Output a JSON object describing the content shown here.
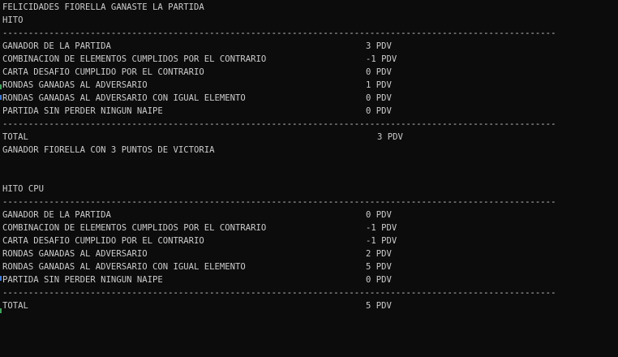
{
  "console": {
    "header": "FELICIDADES FIORELLA GANASTE LA PARTIDA",
    "player_title": "HITO",
    "separator": "-----------------------------------------------------------------------------------------------------------",
    "player_rows": [
      {
        "label": "GANADOR DE LA PARTIDA",
        "value": "3 PDV"
      },
      {
        "label": "COMBINACION DE ELEMENTOS CUMPLIDOS POR EL CONTRARIO",
        "value": "-1 PDV"
      },
      {
        "label": "CARTA DESAFIO CUMPLIDO POR EL CONTRARIO",
        "value": "0 PDV"
      },
      {
        "label": "RONDAS GANADAS AL ADVERSARIO",
        "value": "1 PDV"
      },
      {
        "label": "RONDAS GANADAS AL ADVERSARIO CON IGUAL ELEMENTO",
        "value": "0 PDV"
      },
      {
        "label": "PARTIDA SIN PERDER NINGUN NAIPE",
        "value": "0 PDV"
      }
    ],
    "player_total_label": "TOTAL",
    "player_total_value": "3 PDV",
    "winner_message": "GANADOR FIORELLA CON 3 PUNTOS DE VICTORIA",
    "cpu_title": "HITO CPU",
    "cpu_rows": [
      {
        "label": "GANADOR DE LA PARTIDA",
        "value": "0 PDV"
      },
      {
        "label": "COMBINACION DE ELEMENTOS CUMPLIDOS POR EL CONTRARIO",
        "value": "-1 PDV"
      },
      {
        "label": "CARTA DESAFIO CUMPLIDO POR EL CONTRARIO",
        "value": "-1 PDV"
      },
      {
        "label": "RONDAS GANADAS AL ADVERSARIO",
        "value": "2 PDV"
      },
      {
        "label": "RONDAS GANADAS AL ADVERSARIO CON IGUAL ELEMENTO",
        "value": "5 PDV"
      },
      {
        "label": "PARTIDA SIN PERDER NINGUN NAIPE",
        "value": "0 PDV"
      }
    ],
    "cpu_total_label": "TOTAL",
    "cpu_total_value": "5 PDV"
  },
  "colors": {
    "background": "#0c0c0c",
    "text": "#cccccc",
    "edge_green": "#3aa655",
    "edge_blue": "#3b78d8"
  }
}
